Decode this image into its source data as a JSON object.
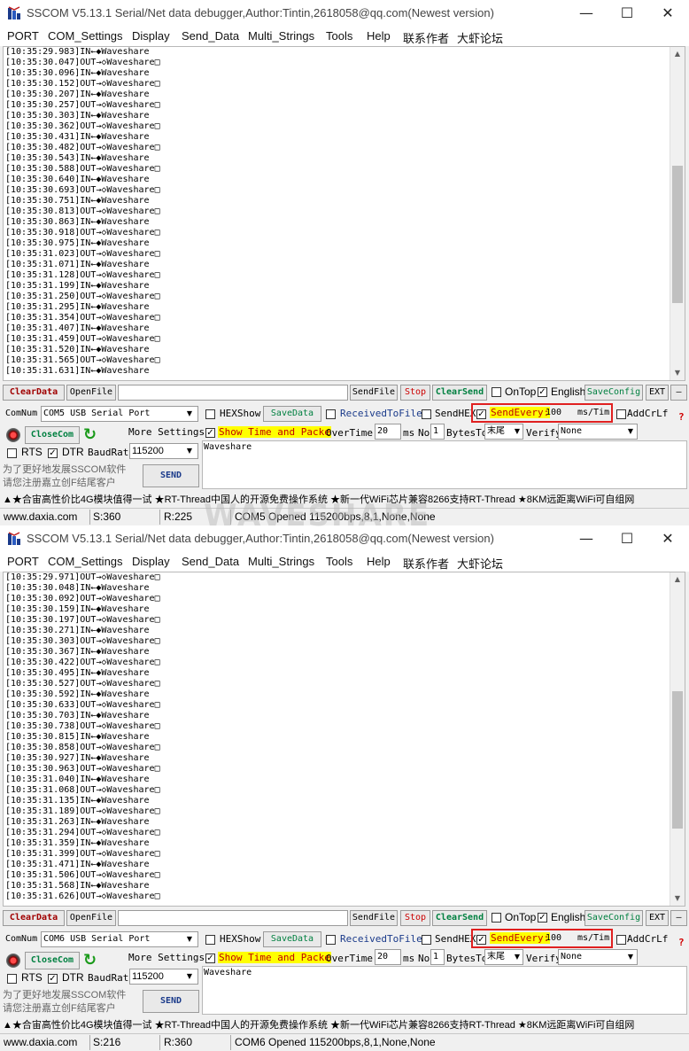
{
  "watermark": "WAVESHARE",
  "windows": [
    {
      "title": "SSCOM V5.13.1 Serial/Net data debugger,Author:Tintin,2618058@qq.com(Newest version)",
      "menu": [
        "PORT",
        "COM_Settings",
        "Display",
        "Send_Data",
        "Multi_Strings",
        "Tools",
        "Help",
        "联系作者",
        "大虾论坛"
      ],
      "log": [
        "[10:35:29.983]IN←◆Waveshare",
        "[10:35:30.047]OUT→◇Waveshare□",
        "[10:35:30.096]IN←◆Waveshare",
        "[10:35:30.152]OUT→◇Waveshare□",
        "[10:35:30.207]IN←◆Waveshare",
        "[10:35:30.257]OUT→◇Waveshare□",
        "[10:35:30.303]IN←◆Waveshare",
        "[10:35:30.362]OUT→◇Waveshare□",
        "[10:35:30.431]IN←◆Waveshare",
        "[10:35:30.482]OUT→◇Waveshare□",
        "[10:35:30.543]IN←◆Waveshare",
        "[10:35:30.588]OUT→◇Waveshare□",
        "[10:35:30.640]IN←◆Waveshare",
        "[10:35:30.693]OUT→◇Waveshare□",
        "[10:35:30.751]IN←◆Waveshare",
        "[10:35:30.813]OUT→◇Waveshare□",
        "[10:35:30.863]IN←◆Waveshare",
        "[10:35:30.918]OUT→◇Waveshare□",
        "[10:35:30.975]IN←◆Waveshare",
        "[10:35:31.023]OUT→◇Waveshare□",
        "[10:35:31.071]IN←◆Waveshare",
        "[10:35:31.128]OUT→◇Waveshare□",
        "[10:35:31.199]IN←◆Waveshare",
        "[10:35:31.250]OUT→◇Waveshare□",
        "[10:35:31.295]IN←◆Waveshare",
        "[10:35:31.354]OUT→◇Waveshare□",
        "[10:35:31.407]IN←◆Waveshare",
        "[10:35:31.459]OUT→◇Waveshare□",
        "[10:35:31.520]IN←◆Waveshare",
        "[10:35:31.565]OUT→◇Waveshare□",
        "[10:35:31.631]IN←◆Waveshare"
      ],
      "controls": {
        "clear_data": "ClearData",
        "open_file": "OpenFile",
        "send_file": "SendFile",
        "stop": "Stop",
        "clear_send": "ClearSend",
        "ontop": "OnTop",
        "english": "English",
        "save_config": "SaveConfig",
        "ext": "EXT",
        "minus": "—",
        "comnum_label": "ComNum",
        "comnum_value": "COM5 USB Serial Port",
        "hex_show": "HEXShow",
        "save_data": "SaveData",
        "received_to_file": "ReceivedToFile",
        "send_hex": "SendHEX",
        "send_every": "SendEvery:",
        "send_every_value": "100",
        "send_every_unit": "ms/Tim",
        "add_crlf": "AddCrLf",
        "close_com": "CloseCom",
        "more_settings": "More Settings",
        "show_time": "Show Time and Packe",
        "overtime_label": "OverTime:",
        "overtime_value": "20",
        "ms": "ms",
        "no_label": "No",
        "no_value": "1",
        "bytes_to": "BytesTo",
        "bytes_to_value": "末尾",
        "verify": "Verify",
        "verify_value": "None",
        "rts": "RTS",
        "dtr": "DTR",
        "baud_label": "BaudRat",
        "baud_value": "115200",
        "send_text": "Waveshare",
        "promo_line1": "为了更好地发展SSCOM软件",
        "promo_line2": "请您注册嘉立创F结尾客户",
        "send": "SEND"
      },
      "ad": "▲★合宙高性价比4G模块值得一试 ★RT-Thread中国人的开源免费操作系统 ★新一代WiFi芯片兼容8266支持RT-Thread ★8KM远距离WiFi可自组网",
      "status": {
        "site": "www.daxia.com",
        "s": "S:360",
        "r": "R:225",
        "port": "COM5 Opened  115200bps,8,1,None,None"
      },
      "scroll_thumb": 0.62
    },
    {
      "title": "SSCOM V5.13.1 Serial/Net data debugger,Author:Tintin,2618058@qq.com(Newest version)",
      "menu": [
        "PORT",
        "COM_Settings",
        "Display",
        "Send_Data",
        "Multi_Strings",
        "Tools",
        "Help",
        "联系作者",
        "大虾论坛"
      ],
      "log": [
        "[10:35:29.971]OUT→◇Waveshare□",
        "[10:35:30.048]IN←◆Waveshare",
        "[10:35:30.092]OUT→◇Waveshare□",
        "[10:35:30.159]IN←◆Waveshare",
        "[10:35:30.197]OUT→◇Waveshare□",
        "[10:35:30.271]IN←◆Waveshare",
        "[10:35:30.303]OUT→◇Waveshare□",
        "[10:35:30.367]IN←◆Waveshare",
        "[10:35:30.422]OUT→◇Waveshare□",
        "[10:35:30.495]IN←◆Waveshare",
        "[10:35:30.527]OUT→◇Waveshare□",
        "[10:35:30.592]IN←◆Waveshare",
        "[10:35:30.633]OUT→◇Waveshare□",
        "[10:35:30.703]IN←◆Waveshare",
        "[10:35:30.738]OUT→◇Waveshare□",
        "[10:35:30.815]IN←◆Waveshare",
        "[10:35:30.858]OUT→◇Waveshare□",
        "[10:35:30.927]IN←◆Waveshare",
        "[10:35:30.963]OUT→◇Waveshare□",
        "[10:35:31.040]IN←◆Waveshare",
        "[10:35:31.068]OUT→◇Waveshare□",
        "[10:35:31.135]IN←◆Waveshare",
        "[10:35:31.189]OUT→◇Waveshare□",
        "[10:35:31.263]IN←◆Waveshare",
        "[10:35:31.294]OUT→◇Waveshare□",
        "[10:35:31.359]IN←◆Waveshare",
        "[10:35:31.399]OUT→◇Waveshare□",
        "[10:35:31.471]IN←◆Waveshare",
        "[10:35:31.506]OUT→◇Waveshare□",
        "[10:35:31.568]IN←◆Waveshare",
        "[10:35:31.626]OUT→◇Waveshare□"
      ],
      "controls": {
        "clear_data": "ClearData",
        "open_file": "OpenFile",
        "send_file": "SendFile",
        "stop": "Stop",
        "clear_send": "ClearSend",
        "ontop": "OnTop",
        "english": "English",
        "save_config": "SaveConfig",
        "ext": "EXT",
        "minus": "—",
        "comnum_label": "ComNum",
        "comnum_value": "COM6 USB Serial Port",
        "hex_show": "HEXShow",
        "save_data": "SaveData",
        "received_to_file": "ReceivedToFile",
        "send_hex": "SendHEX",
        "send_every": "SendEvery:",
        "send_every_value": "100",
        "send_every_unit": "ms/Tim",
        "add_crlf": "AddCrLf",
        "close_com": "CloseCom",
        "more_settings": "More Settings",
        "show_time": "Show Time and Packe",
        "overtime_label": "OverTime:",
        "overtime_value": "20",
        "ms": "ms",
        "no_label": "No",
        "no_value": "1",
        "bytes_to": "BytesTo",
        "bytes_to_value": "末尾",
        "verify": "Verify",
        "verify_value": "None",
        "rts": "RTS",
        "dtr": "DTR",
        "baud_label": "BaudRat",
        "baud_value": "115200",
        "send_text": "Waveshare",
        "promo_line1": "为了更好地发展SSCOM软件",
        "promo_line2": "请您注册嘉立创F结尾客户",
        "send": "SEND"
      },
      "ad": "▲★合宙高性价比4G模块值得一试 ★RT-Thread中国人的开源免费操作系统 ★新一代WiFi芯片兼容8266支持RT-Thread ★8KM远距离WiFi可自组网",
      "status": {
        "site": "www.daxia.com",
        "s": "S:216",
        "r": "R:360",
        "port": "COM6 Opened  115200bps,8,1,None,None"
      },
      "scroll_thumb": 0.62
    }
  ]
}
